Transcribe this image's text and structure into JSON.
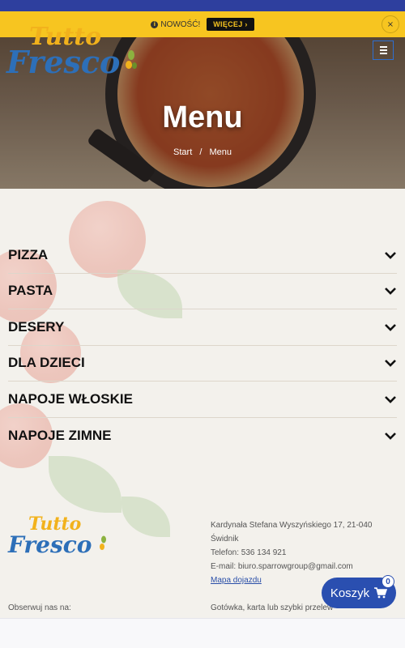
{
  "notice": {
    "text": "NOWOŚĆ!",
    "more_label": "WIĘCEJ ›",
    "close_label": "×"
  },
  "hero": {
    "title": "Menu",
    "breadcrumb": [
      "Start",
      "/",
      "Menu"
    ]
  },
  "logo": {
    "line1": "Tutto",
    "line2": "Fresco"
  },
  "categories": [
    {
      "label": "PIZZA"
    },
    {
      "label": "PASTA"
    },
    {
      "label": "DESERY"
    },
    {
      "label": "DLA DZIECI"
    },
    {
      "label": "NAPOJE WŁOSKIE"
    },
    {
      "label": "NAPOJE ZIMNE"
    }
  ],
  "footer": {
    "address_line1": "Kardynała Stefana Wyszyńskiego 17, 21-040",
    "address_line2": "Świdnik",
    "phone": "Telefon: 536 134 921",
    "email": "E-mail: biuro.sparrowgroup@gmail.com",
    "map_link": "Mapa dojazdu",
    "follow": "Obserwuj nas na:",
    "payment": "Gotówka, karta lub szybki przelew"
  },
  "cart": {
    "label": "Koszyk",
    "count": "0"
  },
  "colors": {
    "accent_blue": "#2a4fb0",
    "notice_yellow": "#f7c520",
    "topbar": "#2e3f9e"
  }
}
